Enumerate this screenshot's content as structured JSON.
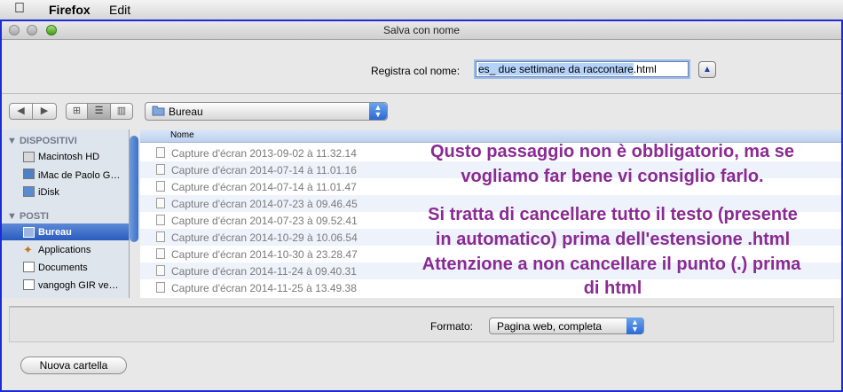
{
  "menubar": {
    "apple_icon": "apple-logo-icon",
    "app_name": "Firefox",
    "edit": "Edit"
  },
  "window": {
    "title": "Salva con nome"
  },
  "save_as": {
    "label": "Registra col nome:",
    "value_selected": "es_ due settimane da raccontare",
    "value_extension": ".html"
  },
  "toolbar": {
    "back_icon": "◀",
    "forward_icon": "▶",
    "view_icon": "⊞",
    "view_list": "☰",
    "view_columns": "▥",
    "location": "Bureau"
  },
  "sidebar": {
    "sections": [
      {
        "title": "DISPOSITIVI",
        "items": [
          "Macintosh HD",
          "iMac de Paolo G…",
          "iDisk"
        ]
      },
      {
        "title": "POSTI",
        "items": [
          "Bureau",
          "Applications",
          "Documents",
          "vangogh GIR ve…"
        ]
      }
    ],
    "selected": "Bureau"
  },
  "file_list": {
    "header": "Nome",
    "files": [
      "Capture d'écran 2013-09-02 à 11.32.14",
      "Capture d'écran 2014-07-14 à 11.01.16",
      "Capture d'écran 2014-07-14 à 11.01.47",
      "Capture d'écran 2014-07-23 à 09.46.45",
      "Capture d'écran 2014-07-23 à 09.52.41",
      "Capture d'écran 2014-10-29 à 10.06.54",
      "Capture d'écran 2014-10-30 à 23.28.47",
      "Capture d'écran 2014-11-24 à 09.40.31",
      "Capture d'écran 2014-11-25 à 13.49.38"
    ]
  },
  "annotation": {
    "lines": [
      "Qusto passaggio non è obbligatorio, ma se",
      "vogliamo far bene vi consiglio farlo.",
      "Si tratta di cancellare tutto il testo (presente",
      "in automatico) prima dell'estensione .html",
      "Attenzione a non cancellare il punto (.) prima",
      "di html"
    ],
    "color": "#8a2a93"
  },
  "format": {
    "label": "Formato:",
    "value": "Pagina web, completa"
  },
  "buttons": {
    "new_folder": "Nuova cartella"
  },
  "colors": {
    "frame": "#1b2bd6",
    "selection": "#3a6cc8"
  }
}
